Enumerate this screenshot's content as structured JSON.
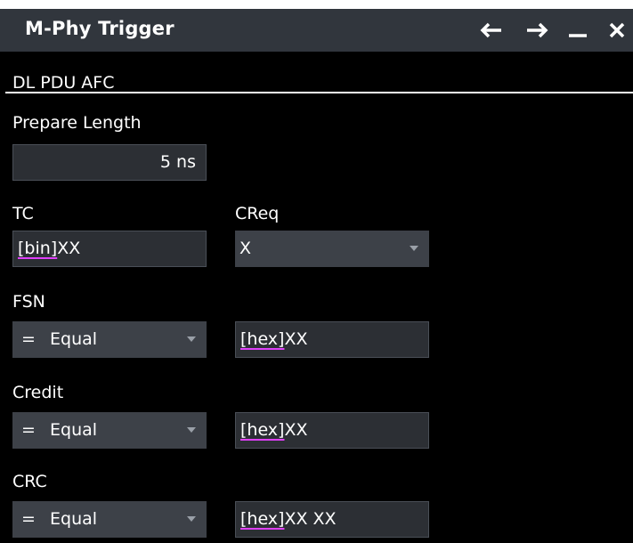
{
  "window": {
    "title": "M-Phy Trigger",
    "buttons": [
      "back-icon",
      "forward-icon",
      "minimize-icon",
      "close-icon"
    ]
  },
  "section": {
    "title": "DL PDU AFC"
  },
  "prepare_length": {
    "label": "Prepare Length",
    "value": "5 ns"
  },
  "tc": {
    "label": "TC",
    "prefix": "[bin]",
    "value": "XX"
  },
  "creq": {
    "label": "CReq",
    "value": "X"
  },
  "fsn": {
    "label": "FSN",
    "operator_symbol": "=",
    "operator": "Equal",
    "prefix": "[hex]",
    "value": "XX"
  },
  "credit": {
    "label": "Credit",
    "operator_symbol": "=",
    "operator": "Equal",
    "prefix": "[hex]",
    "value": "XX"
  },
  "crc": {
    "label": "CRC",
    "operator_symbol": "=",
    "operator": "Equal",
    "prefix": "[hex]",
    "value": "XX XX"
  },
  "colors": {
    "titlebar": "#31363d",
    "background": "#000000",
    "field": "#2c2f34",
    "dropdown": "#3d4148",
    "prefix_underline": "#e040fb"
  }
}
